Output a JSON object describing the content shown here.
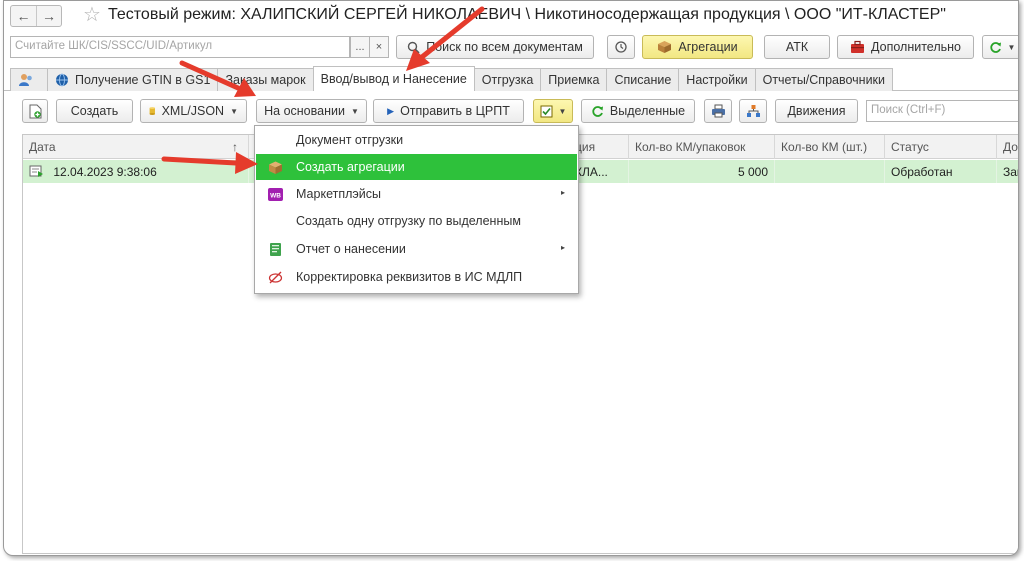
{
  "window": {
    "title": "Тестовый режим:  ХАЛИПСКИЙ СЕРГЕЙ НИКОЛАЕВИЧ \\ Никотиносодержащая продукция \\ ООО \"ИТ-КЛАСТЕР\""
  },
  "topbar": {
    "scan_placeholder": "Считайте ШК/CIS/SSCC/UID/Артикул",
    "more_label": "...",
    "clear_label": "×",
    "search_all_label": "Поиск по всем документам",
    "aggregations_label": "Агрегации",
    "atk_label": "АТК",
    "additional_label": "Дополнительно"
  },
  "tabs": [
    {
      "label": ""
    },
    {
      "label": "Получение GTIN в GS1"
    },
    {
      "label": "Заказы марок"
    },
    {
      "label": "Ввод/вывод и Нанесение"
    },
    {
      "label": "Отгрузка"
    },
    {
      "label": "Приемка"
    },
    {
      "label": "Списание"
    },
    {
      "label": "Настройки"
    },
    {
      "label": "Отчеты/Справочники"
    }
  ],
  "active_tab": "Ввод/вывод и Нанесение",
  "toolbar": {
    "create_label": "Создать",
    "xml_json_label": "XML/JSON",
    "based_on_label": "На основании",
    "send_label": "Отправить в ЦРПТ",
    "selected_label": "Выделенные",
    "movements_label": "Движения",
    "search_placeholder": "Поиск (Ctrl+F)"
  },
  "table": {
    "columns": [
      "Дата",
      "Н",
      "",
      "ция",
      "Кол-во КМ/упаковок",
      "Кол-во КМ (шт.)",
      "Статус",
      "Док"
    ],
    "sort_indicator": "↑",
    "rows": [
      {
        "date": "12.04.2023 9:38:06",
        "num": "",
        "doc": "",
        "org": "КЛА...",
        "km_pack": "5 000",
        "km_pcs": "",
        "status": "Обработан",
        "doc_type": "Зака"
      }
    ]
  },
  "menu": {
    "items": [
      {
        "label": "Документ отгрузки",
        "icon": "",
        "submenu": false
      },
      {
        "label": "Создать агрегации",
        "icon": "box-icon",
        "submenu": false,
        "highlighted": true
      },
      {
        "label": "Маркетплэйсы",
        "icon": "wb-icon",
        "submenu": true
      },
      {
        "label": "Создать одну отгрузку по выделенным",
        "icon": "",
        "submenu": false
      },
      {
        "label": "Отчет о нанесении",
        "icon": "report-icon",
        "submenu": true
      },
      {
        "label": "Корректировка реквизитов в ИС МДЛП",
        "icon": "edit-icon",
        "submenu": false
      }
    ],
    "submenu_arrow": "▸"
  },
  "icons": {
    "wb_badge": "WB"
  },
  "colors": {
    "highlight_green": "#2ec13b",
    "row_green": "#d3f1d1",
    "arrow_red": "#e53b2c",
    "aggregations_yellow": "#f2e783"
  }
}
